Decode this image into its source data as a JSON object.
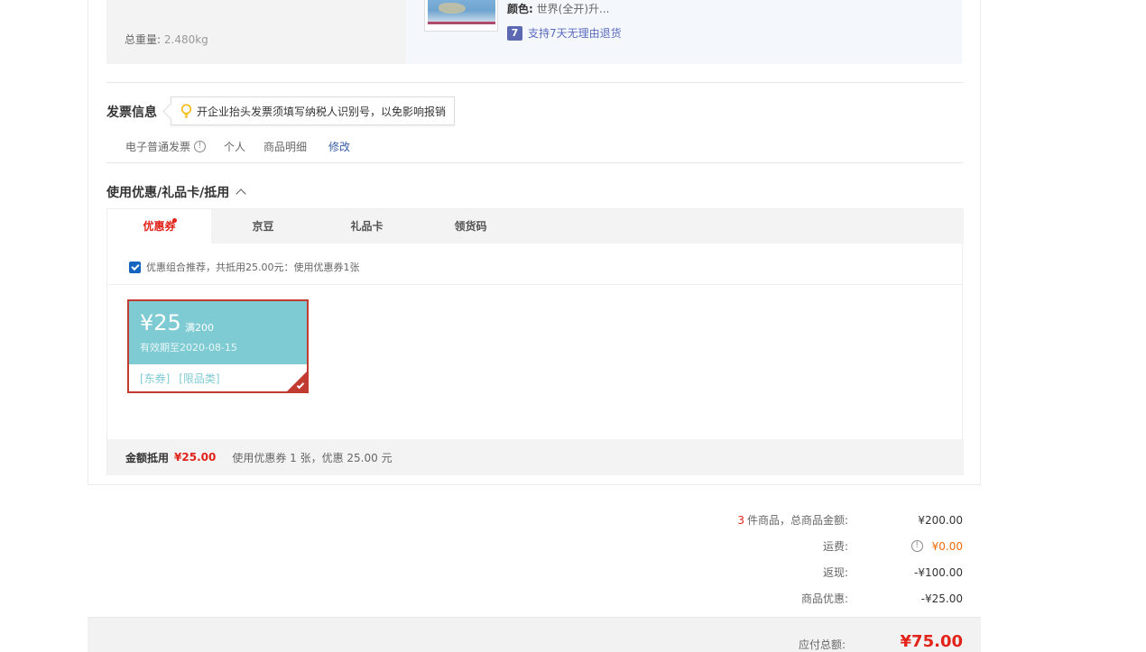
{
  "product": {
    "weight_label": "总重量:",
    "weight_value": "2.480kg",
    "color_label": "颜色:",
    "color_value": "世界(全开)升...",
    "return_badge": "7",
    "return_text": "支持7天无理由退货"
  },
  "invoice": {
    "title": "发票信息",
    "tip": "开企业抬头发票须填写纳税人识别号，以免影响报销",
    "type": "电子普通发票",
    "title_type": "个人",
    "content": "商品明细",
    "edit": "修改"
  },
  "coupons": {
    "title": "使用优惠/礼品卡/抵用",
    "tabs": [
      "优惠券",
      "京豆",
      "礼品卡",
      "领货码"
    ],
    "active_tab": 0,
    "recommend": "优惠组合推荐，共抵用25.00元：使用优惠券1张",
    "recommend_checked": true,
    "coupon": {
      "amount": "¥25",
      "condition": "满200",
      "expire": "有效期至2020-08-15",
      "tag1": "[东券]",
      "tag2": "[限品类]",
      "selected": true
    },
    "summary_label": "金额抵用",
    "summary_amount": "¥25.00",
    "summary_desc": "使用优惠券 1 张，优惠 25.00 元"
  },
  "totals": {
    "count": "3",
    "items_label": "件商品，总商品金额:",
    "items_value": "¥200.00",
    "shipping_label": "运费:",
    "shipping_value": "¥0.00",
    "cashback_label": "返现:",
    "cashback_value": "-¥100.00",
    "discount_label": "商品优惠:",
    "discount_value": "-¥25.00",
    "payable_label": "应付总额:",
    "payable_value": "¥75.00"
  },
  "colors": {
    "accent_red": "#e2231a",
    "coupon_teal": "#7ecbd3",
    "link_blue": "#3a5fa8",
    "shipping_orange": "#f06b0b"
  }
}
